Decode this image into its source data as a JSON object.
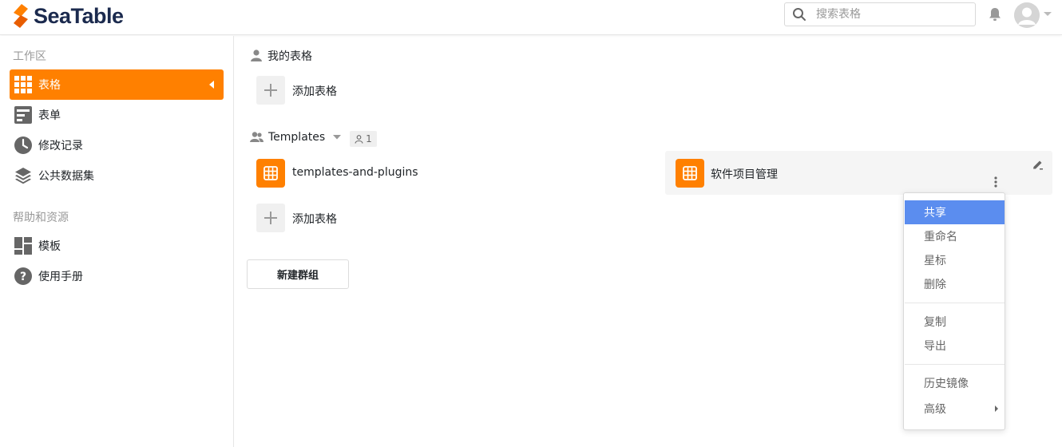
{
  "header": {
    "logo_text": "SeaTable",
    "search_placeholder": "搜索表格",
    "brand_color": "#ff8000"
  },
  "sidebar": {
    "workspace_heading": "工作区",
    "items": [
      {
        "label": "表格",
        "icon": "grid-icon",
        "active": true
      },
      {
        "label": "表单",
        "icon": "form-icon"
      },
      {
        "label": "修改记录",
        "icon": "clock-icon"
      },
      {
        "label": "公共数据集",
        "icon": "layers-icon"
      }
    ],
    "help_heading": "帮助和资源",
    "help_items": [
      {
        "label": "模板",
        "icon": "template-icon"
      },
      {
        "label": "使用手册",
        "icon": "help-icon"
      }
    ]
  },
  "main": {
    "my_tables": {
      "title": "我的表格",
      "add_label": "添加表格"
    },
    "group": {
      "name": "Templates",
      "member_count": "1",
      "tables": [
        {
          "name": "templates-and-plugins"
        },
        {
          "name": "软件项目管理"
        }
      ],
      "add_label": "添加表格"
    },
    "new_group_label": "新建群组"
  },
  "context_menu": {
    "items": [
      {
        "label": "共享",
        "active": true
      },
      {
        "label": "重命名"
      },
      {
        "label": "星标"
      },
      {
        "label": "删除"
      },
      {
        "label": "复制"
      },
      {
        "label": "导出"
      },
      {
        "label": "历史镜像"
      },
      {
        "label": "高级",
        "has_submenu": true
      }
    ],
    "active_color": "#5b8def"
  }
}
